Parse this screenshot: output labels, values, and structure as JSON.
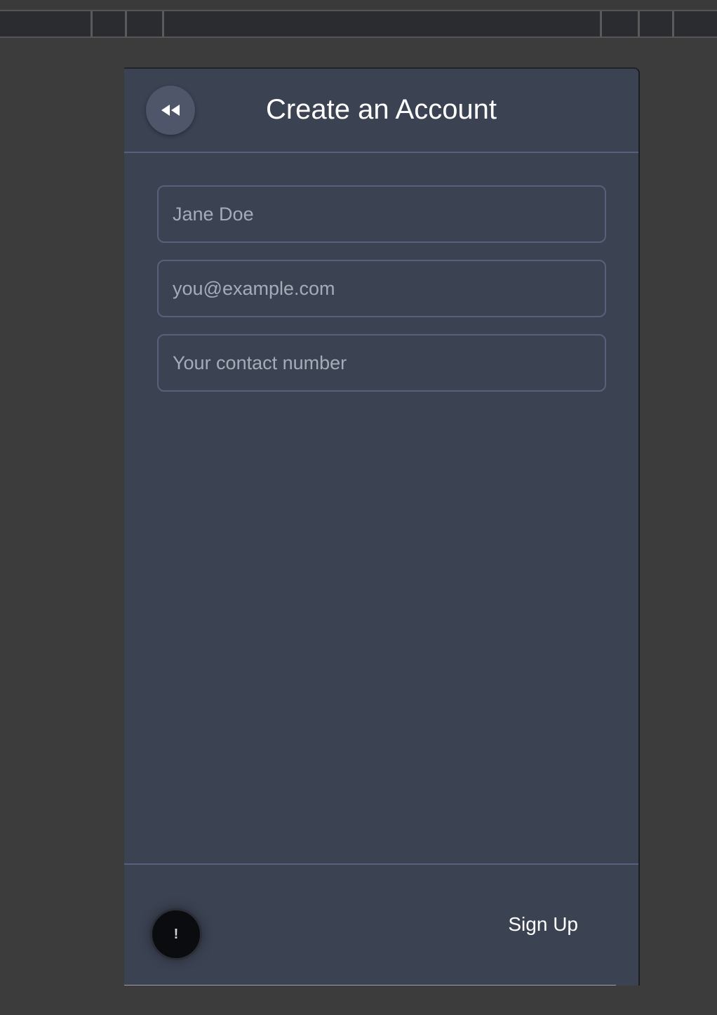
{
  "header": {
    "title": "Create an Account",
    "back_icon": "rewind-icon"
  },
  "form": {
    "name_placeholder": "Jane Doe",
    "email_placeholder": "you@example.com",
    "phone_placeholder": "Your contact number"
  },
  "footer": {
    "help_glyph": "!",
    "signup_label": "Sign Up"
  }
}
